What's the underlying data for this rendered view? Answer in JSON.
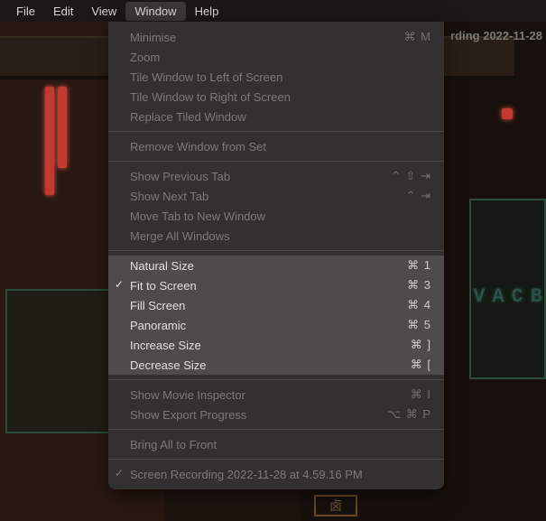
{
  "menubar": {
    "items": [
      {
        "label": "File"
      },
      {
        "label": "Edit"
      },
      {
        "label": "View"
      },
      {
        "label": "Window"
      },
      {
        "label": "Help"
      }
    ],
    "active_index": 3
  },
  "bg": {
    "title_behind": "rding 2022-11-28",
    "vacb_text": "VACB",
    "sign_text": "卤"
  },
  "menu": {
    "g1": [
      {
        "label": "Minimise",
        "shortcut": "⌘ M",
        "enabled": false
      },
      {
        "label": "Zoom",
        "shortcut": "",
        "enabled": false
      },
      {
        "label": "Tile Window to Left of Screen",
        "shortcut": "",
        "enabled": false
      },
      {
        "label": "Tile Window to Right of Screen",
        "shortcut": "",
        "enabled": false
      },
      {
        "label": "Replace Tiled Window",
        "shortcut": "",
        "enabled": false
      }
    ],
    "g2": [
      {
        "label": "Remove Window from Set",
        "shortcut": "",
        "enabled": false
      }
    ],
    "g3": [
      {
        "label": "Show Previous Tab",
        "shortcut": "⌃ ⇧ ⇥",
        "enabled": false
      },
      {
        "label": "Show Next Tab",
        "shortcut": "⌃ ⇥",
        "enabled": false
      },
      {
        "label": "Move Tab to New Window",
        "shortcut": "",
        "enabled": false
      },
      {
        "label": "Merge All Windows",
        "shortcut": "",
        "enabled": false
      }
    ],
    "g4": [
      {
        "label": "Natural Size",
        "shortcut": "⌘ 1",
        "enabled": true,
        "checked": false
      },
      {
        "label": "Fit to Screen",
        "shortcut": "⌘ 3",
        "enabled": true,
        "checked": true
      },
      {
        "label": "Fill Screen",
        "shortcut": "⌘ 4",
        "enabled": true,
        "checked": false
      },
      {
        "label": "Panoramic",
        "shortcut": "⌘ 5",
        "enabled": true,
        "checked": false
      },
      {
        "label": "Increase Size",
        "shortcut": "⌘ ]",
        "enabled": true,
        "checked": false
      },
      {
        "label": "Decrease Size",
        "shortcut": "⌘ [",
        "enabled": true,
        "checked": false
      }
    ],
    "g5": [
      {
        "label": "Show Movie Inspector",
        "shortcut": "⌘ I",
        "enabled": false
      },
      {
        "label": "Show Export Progress",
        "shortcut": "⌥ ⌘ P",
        "enabled": false
      }
    ],
    "g6": [
      {
        "label": "Bring All to Front",
        "shortcut": "",
        "enabled": false
      }
    ],
    "g7": [
      {
        "label": "Screen Recording 2022-11-28 at 4.59.16 PM",
        "shortcut": "",
        "enabled": false,
        "checked": true
      }
    ]
  }
}
